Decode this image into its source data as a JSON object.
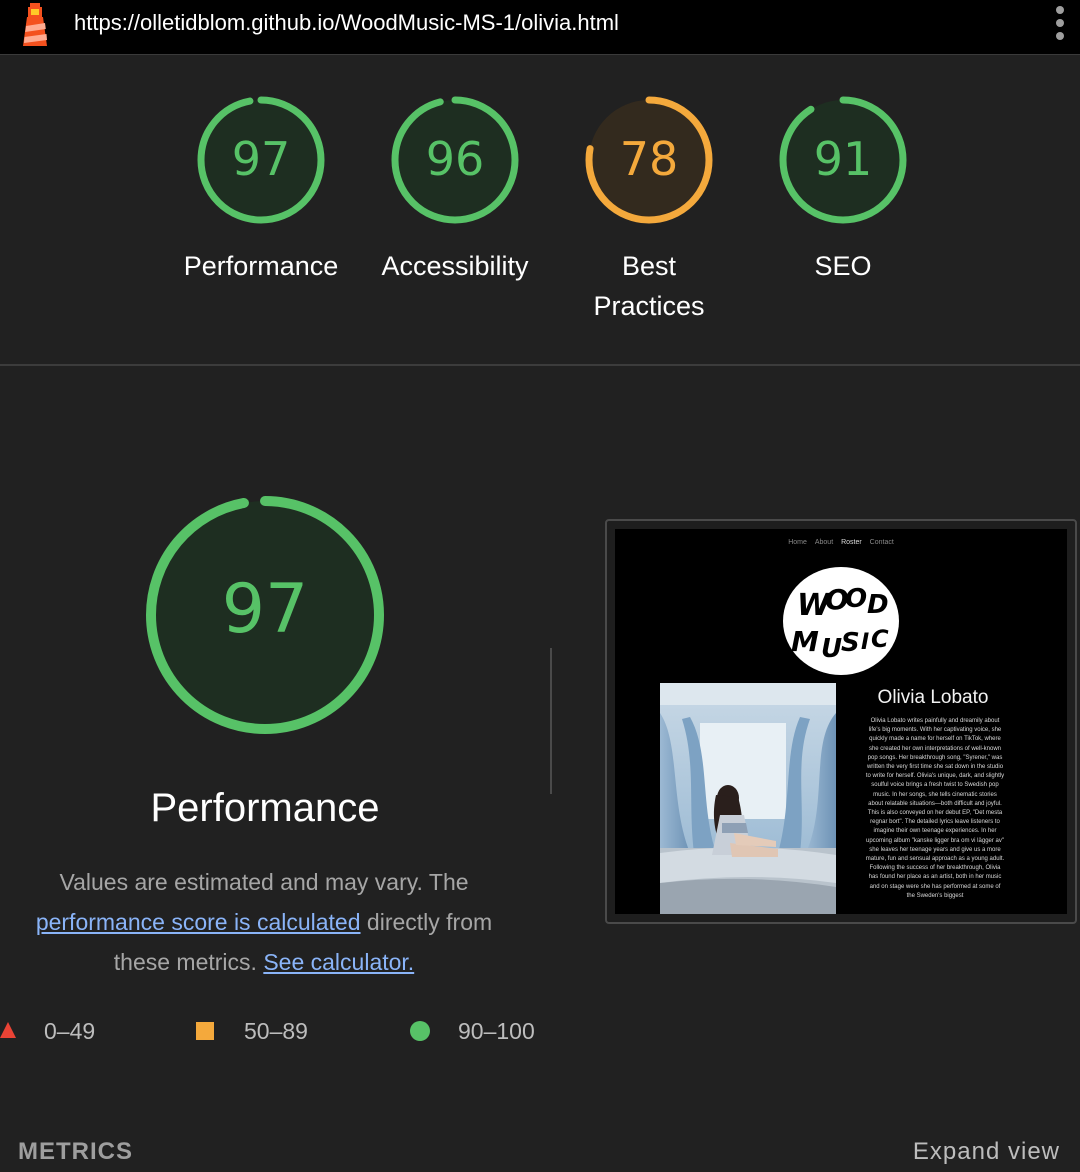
{
  "browser": {
    "url": "https://olletidblom.github.io/WoodMusic-MS-1/olivia.html"
  },
  "scores": [
    {
      "label": "Performance",
      "value": "97",
      "fraction": 0.97,
      "status": "pass",
      "color": "#57c267"
    },
    {
      "label": "Accessibility",
      "value": "96",
      "fraction": 0.96,
      "status": "pass",
      "color": "#57c267"
    },
    {
      "label": "Best Practices",
      "value": "78",
      "fraction": 0.78,
      "status": "average",
      "color": "#f4a93c"
    },
    {
      "label": "SEO",
      "value": "91",
      "fraction": 0.91,
      "status": "pass",
      "color": "#57c267"
    }
  ],
  "performance": {
    "score": "97",
    "fraction": 0.97,
    "title": "Performance",
    "desc_before": "Values are estimated and may vary. The ",
    "link1": "performance score is calculated",
    "desc_middle": " directly from these metrics. ",
    "link2": "See calculator."
  },
  "legend": [
    {
      "range": "0–49",
      "icon": "triangle-icon",
      "color": "#ea4335"
    },
    {
      "range": "50–89",
      "icon": "square-icon",
      "color": "#f4a93c"
    },
    {
      "range": "90–100",
      "icon": "circle-icon",
      "color": "#57c267"
    }
  ],
  "preview": {
    "nav": [
      "Home",
      "About",
      "Roster",
      "Contact"
    ],
    "active_nav": "Roster",
    "logo_text": "WOOD MUSIC",
    "artist_name": "Olivia Lobato",
    "bio": "Olivia Lobato writes painfully and dreamily about life's big moments. With her captivating voice, she quickly made a name for herself on TikTok, where she created her own interpretations of well-known pop songs. Her breakthrough song, \"Syrener,\" was written the very first time she sat down in the studio to write for herself. Olivia's unique, dark, and slightly soulful voice brings a fresh twist to Swedish pop music. In her songs, she tells cinematic stories about relatable situations—both difficult and joyful. This is also conveyed on her debut EP, \"Det mesta regnar bort\". The detailed lyrics leave listeners to imagine their own teenage experiences. In her upcoming album \"kanske ligger bra om vi lägger av\" she leaves her teenage years and give us a more mature, fun and sensual approach as a young adult. Following the success of her breakthrough, Olivia has found her place as an artist, both in her music and on stage were she has performed at some of the Sweden's biggest"
  },
  "footer": {
    "metrics_label": "METRICS",
    "expand_label": "Expand view"
  }
}
